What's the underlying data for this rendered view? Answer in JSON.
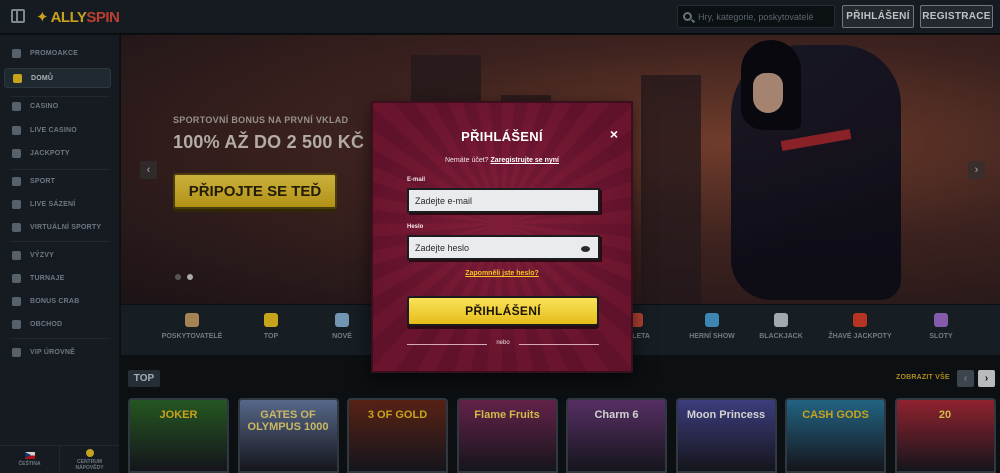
{
  "header": {
    "logo_part1": "ALLY",
    "logo_part2": "SPIN",
    "search_placeholder": "Hry, kategorie, poskytovatelé",
    "login_label": "PŘIHLÁŠENÍ",
    "register_label": "REGISTRACE"
  },
  "sidebar": {
    "items": [
      {
        "label": "PROMOAKCE",
        "icon": "promo-icon"
      },
      {
        "label": "DOMŮ",
        "icon": "home-icon",
        "active": true
      },
      {
        "label": "CASINO",
        "icon": "casino-icon"
      },
      {
        "label": "LIVE CASINO",
        "icon": "live-casino-icon"
      },
      {
        "label": "JACKPOTY",
        "icon": "jackpot-icon"
      },
      {
        "label": "SPORT",
        "icon": "sport-icon"
      },
      {
        "label": "LIVE SÁZENÍ",
        "icon": "live-betting-icon"
      },
      {
        "label": "VIRTUÁLNÍ SPORTY",
        "icon": "virtual-sports-icon"
      },
      {
        "label": "VÝZVY",
        "icon": "challenges-icon"
      },
      {
        "label": "TURNAJE",
        "icon": "tournaments-icon"
      },
      {
        "label": "BONUS CRAB",
        "icon": "bonus-crab-icon"
      },
      {
        "label": "OBCHOD",
        "icon": "shop-icon"
      },
      {
        "label": "VIP ÚROVNĚ",
        "icon": "vip-icon"
      }
    ],
    "bottom": {
      "language_label": "ČEŠTINA",
      "help_label_line1": "CENTRUM",
      "help_label_line2": "NÁPOVĚDY"
    }
  },
  "banner": {
    "subtitle": "SPORTOVNÍ BONUS NA PRVNÍ VKLAD",
    "title": "100% AŽ DO 2 500 KČ",
    "cta_label": "PŘIPOJTE SE TEĎ",
    "prev_arrow": "‹",
    "next_arrow": "›",
    "active_slide": 1,
    "slide_count": 2
  },
  "categories": [
    {
      "label": "POSKYTOVATELÉ",
      "color": "#c9a06a"
    },
    {
      "label": "TOP",
      "color": "#f3c623"
    },
    {
      "label": "NOVÉ",
      "color": "#8ab6d9"
    },
    {
      "label": "RULETA",
      "color": "#d9503c"
    },
    {
      "label": "HERNÍ SHOW",
      "color": "#4aa3d9"
    },
    {
      "label": "BLACKJACK",
      "color": "#c9cfd6"
    },
    {
      "label": "ŽHAVÉ JACKPOTY",
      "color": "#e0402a"
    },
    {
      "label": "SLOTY",
      "color": "#a070d0"
    }
  ],
  "top_section": {
    "tag": "TOP",
    "show_all": "ZOBRAZIT VŠE",
    "prev": "‹",
    "next": "›"
  },
  "games": [
    {
      "name": "JOKER",
      "color": "#f3c623",
      "bg": "#2d6a2a"
    },
    {
      "name": "GATES OF OLYMPUS 1000",
      "color": "#f6e07a",
      "bg": "#6a7fa8"
    },
    {
      "name": "3 OF GOLD",
      "color": "#f3c623",
      "bg": "#6b2a1a"
    },
    {
      "name": "Flame Fruits",
      "color": "#ffe15a",
      "bg": "#7a2a5a"
    },
    {
      "name": "Charm 6",
      "color": "#ffffff",
      "bg": "#6a3a7a"
    },
    {
      "name": "Moon Princess",
      "color": "#ffffff",
      "bg": "#4a4a9a"
    },
    {
      "name": "CASH GODS",
      "color": "#f3c623",
      "bg": "#2a7aa0"
    },
    {
      "name": "20",
      "color": "#ffe15a",
      "bg": "#b02a3a"
    }
  ],
  "modal": {
    "title": "PŘIHLÁŠENÍ",
    "close": "×",
    "no_account_text": "Nemáte účet?",
    "register_link": "Zaregistrujte se nyní",
    "email_label": "E-mail",
    "email_placeholder": "Zadejte e-mail",
    "password_label": "Heslo",
    "password_placeholder": "Zadejte heslo",
    "forgot_password": "Zapomněli jste heslo?",
    "submit_label": "PŘIHLÁŠENÍ",
    "or_label": "nebo"
  },
  "colors": {
    "accent_yellow": "#f3c623",
    "modal_red": "#7a1934",
    "sidebar_bg": "#1a2228"
  }
}
